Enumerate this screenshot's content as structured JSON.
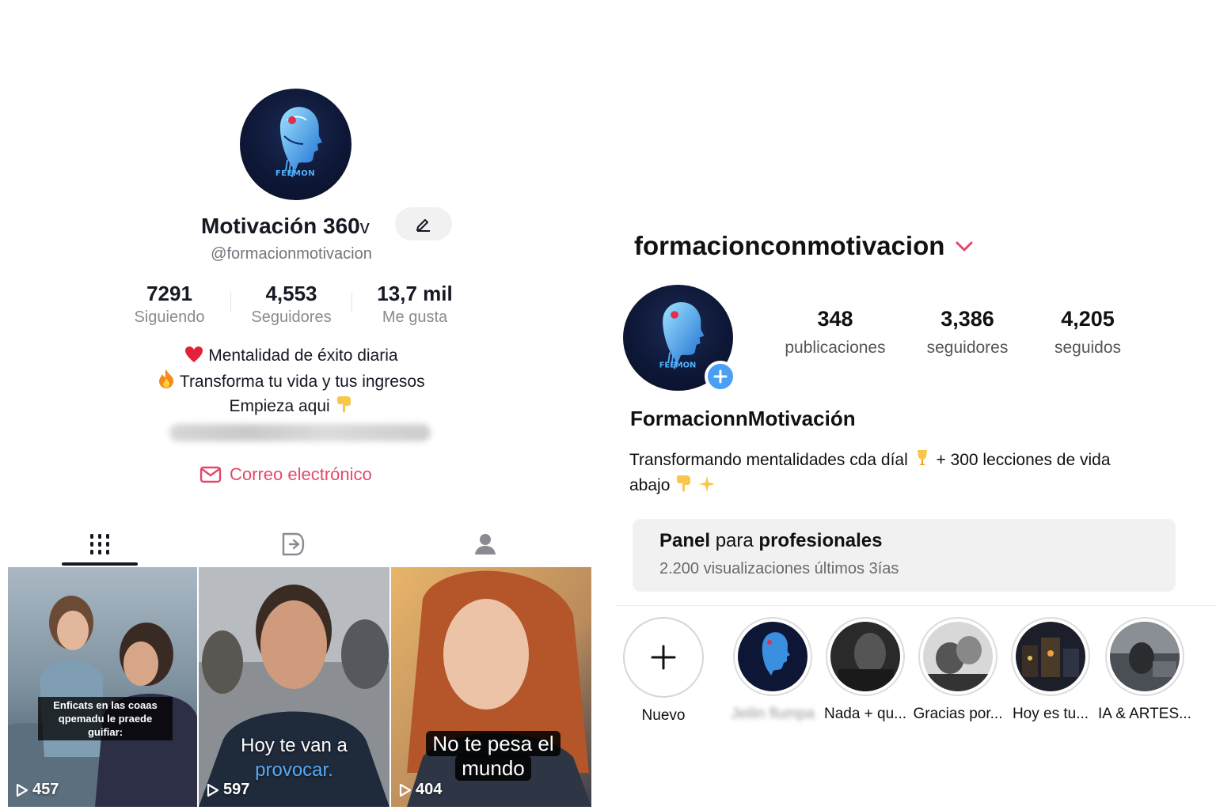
{
  "left_profile": {
    "display_name": "Motivación 360",
    "name_suffix": "v",
    "handle": "@formacionmotivacion",
    "stats": [
      {
        "value": "7291",
        "label": "Siguiendo"
      },
      {
        "value": "4,553",
        "label": "Seguidores"
      },
      {
        "value": "13,7 mil",
        "label": "Me gusta"
      }
    ],
    "bio": {
      "line1": "Mentalidad de éxito diaria",
      "line2": "Transforma tu vida y tus ingresos",
      "line3": "Empieza aqui",
      "line1_icon": "heart-icon",
      "line2_icon": "fire-icon",
      "line3_icon": "pointing-down-icon"
    },
    "email_label": "Correo electrónico",
    "tabs": [
      "videos-grid-icon",
      "reposts-icon",
      "profile-tagged-icon"
    ],
    "videos": [
      {
        "plays": "457",
        "caption_line1": "Enficats en las coaas",
        "caption_line2": "qpemadu le praede guifiar:"
      },
      {
        "plays": "597",
        "caption_line1": "Hoy te van a",
        "caption_line2": "provocar."
      },
      {
        "plays": "404",
        "caption_line1": "No te pesa el",
        "caption_line2": "mundo"
      }
    ]
  },
  "right_profile": {
    "username": "formacionconmotivacion",
    "stats": [
      {
        "value": "348",
        "label": "publicaciones"
      },
      {
        "value": "3,386",
        "label": "seguidores"
      },
      {
        "value": "4,205",
        "label": "seguidos"
      }
    ],
    "display_name": "FormacionnMotivación",
    "bio_line1": "Transformando mentalidades cda díal",
    "bio_line1_rest": "+ 300 lecciones de vida",
    "bio_line2": "abajo",
    "panel": {
      "title_bold1": "Panel",
      "title_mid": "para",
      "title_bold2": "profesionales",
      "subtitle": "2.200 visualizaciones últimos 3ías"
    },
    "highlights": [
      {
        "label": "Nuevo"
      },
      {
        "label": "Jeilin flumpa"
      },
      {
        "label": "Nada + qu..."
      },
      {
        "label": "Gracias por..."
      },
      {
        "label": "Hoy es tu..."
      },
      {
        "label": "IA & ARTES..."
      }
    ]
  },
  "colors": {
    "accent_pink": "#e34969",
    "ig_blue": "#4a9ff5",
    "avatar_bg": "#0d1634"
  },
  "logo_text": "FEEMON"
}
